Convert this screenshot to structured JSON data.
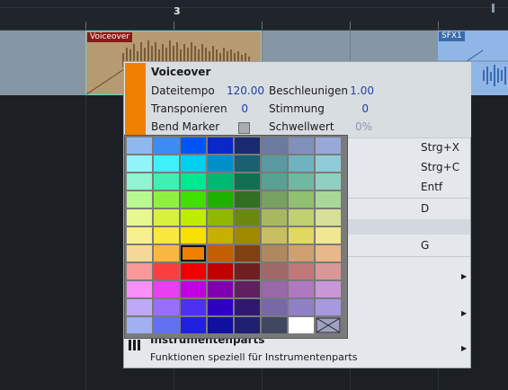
{
  "ruler": {
    "bar_number": "3"
  },
  "events": {
    "voiceover": {
      "name": "Voiceover",
      "color": "#b69b72"
    },
    "sfx": {
      "name": "SFX1",
      "color": "#8fb6e6"
    }
  },
  "menu": {
    "title": "Voiceover",
    "accent_color": "#f08000",
    "props": {
      "dateitempo_label": "Dateitempo",
      "dateitempo_value": "120.00",
      "beschleunigen_label": "Beschleunigen",
      "beschleunigen_value": "1.00",
      "transponieren_label": "Transponieren",
      "transponieren_value": "0",
      "stimmung_label": "Stimmung",
      "stimmung_value": "0",
      "bend_marker_label": "Bend Marker",
      "schwellwert_label": "Schwellwert",
      "schwellwert_value": "0%"
    },
    "shortcuts": [
      "Strg+X",
      "Strg+C",
      "Entf",
      "D",
      "G"
    ],
    "instrument_title": "Instrumentenparts",
    "instrument_desc": "Funktionen speziell für Instrumentenparts",
    "submenu_icon": "triangle-right-icon"
  },
  "palette": {
    "rows": [
      [
        "#8fb8f0",
        "#3d8cf2",
        "#0054f4",
        "#0a28c8",
        "#1a2a70",
        "#6a7aa0",
        "#8092bc",
        "#98a8d8"
      ],
      [
        "#90f4fa",
        "#40f0f8",
        "#00d0ee",
        "#0090c8",
        "#1a6070",
        "#5a9aa0",
        "#70b2c0",
        "#90ccd8"
      ],
      [
        "#90f4d0",
        "#40f0b0",
        "#00e890",
        "#00b870",
        "#107050",
        "#5aa090",
        "#70b8a0",
        "#90d0c0"
      ],
      [
        "#b8f890",
        "#90f040",
        "#40e000",
        "#20b000",
        "#307020",
        "#78a060",
        "#90c070",
        "#a8d898"
      ],
      [
        "#e8f890",
        "#d8f040",
        "#c0ec00",
        "#90b800",
        "#6a8810",
        "#a8b860",
        "#c0d070",
        "#d8e098"
      ],
      [
        "#f8f090",
        "#f8e840",
        "#f8e000",
        "#c8b000",
        "#a08a00",
        "#c8c060",
        "#e0d860",
        "#f0e890"
      ],
      [
        "#f8d898",
        "#f8b840",
        "#f08000",
        "#c06000",
        "#804010",
        "#b08860",
        "#d0a070",
        "#e8b888"
      ],
      [
        "#f89898",
        "#f84040",
        "#f00000",
        "#c00000",
        "#702020",
        "#a06868",
        "#c07878",
        "#d89898"
      ],
      [
        "#f890f8",
        "#e840f0",
        "#c000e0",
        "#8000b0",
        "#602060",
        "#9868a8",
        "#b078c0",
        "#c898d8"
      ],
      [
        "#c0a8f8",
        "#9870f8",
        "#5030f0",
        "#3000c0",
        "#301870",
        "#7868a8",
        "#9080c8",
        "#a898e0"
      ],
      [
        "#a0b0f0",
        "#6070f0",
        "#2020e0",
        "#1010a0",
        "#202070",
        "#404860",
        "#ffffff",
        "#a0a0c0"
      ]
    ],
    "selected": [
      6,
      2
    ],
    "none_icon": "no-color-icon"
  }
}
